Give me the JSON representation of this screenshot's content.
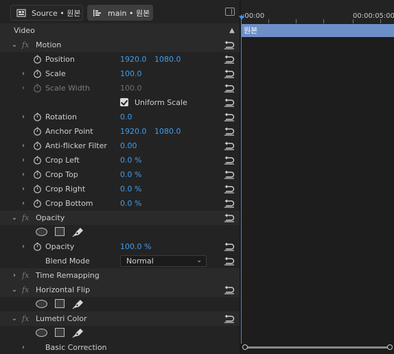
{
  "tabs": {
    "source": "Source • 원본",
    "main": "main • 원본"
  },
  "section": {
    "label": "Video"
  },
  "rows": {
    "motion": "Motion",
    "position": {
      "label": "Position",
      "x": "1920.0",
      "y": "1080.0"
    },
    "scale": {
      "label": "Scale",
      "value": "100.0"
    },
    "scale_width": {
      "label": "Scale Width",
      "value": "100.0"
    },
    "uniform_scale": {
      "label": "Uniform Scale",
      "checked": true
    },
    "rotation": {
      "label": "Rotation",
      "value": "0.0"
    },
    "anchor_point": {
      "label": "Anchor Point",
      "x": "1920.0",
      "y": "1080.0"
    },
    "anti_flicker": {
      "label": "Anti-flicker Filter",
      "value": "0.00"
    },
    "crop_left": {
      "label": "Crop Left",
      "value": "0.0 %"
    },
    "crop_top": {
      "label": "Crop Top",
      "value": "0.0 %"
    },
    "crop_right": {
      "label": "Crop Right",
      "value": "0.0 %"
    },
    "crop_bottom": {
      "label": "Crop Bottom",
      "value": "0.0 %"
    },
    "opacity_group": "Opacity",
    "opacity": {
      "label": "Opacity",
      "value": "100.0 %"
    },
    "blend_mode": {
      "label": "Blend Mode",
      "value": "Normal"
    },
    "time_remapping": "Time Remapping",
    "horizontal_flip": "Horizontal Flip",
    "lumetri_color": "Lumetri Color",
    "basic_correction": "Basic Correction"
  },
  "timeline": {
    "tc_start": ":00:00",
    "tc_mid": "00:00:05:00",
    "clip_label": "원본"
  },
  "colors": {
    "value_blue": "#3f9ef0",
    "clip_blue": "#6d8fc7",
    "playhead": "#3f8fe6"
  }
}
